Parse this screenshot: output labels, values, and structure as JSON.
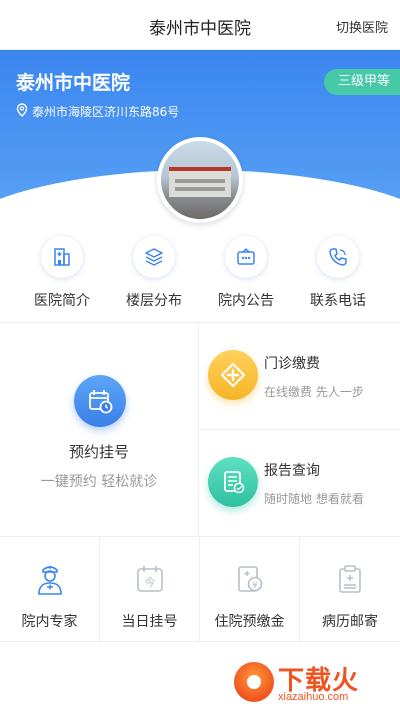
{
  "header": {
    "title": "泰州市中医院",
    "switch_label": "切换医院"
  },
  "hospital": {
    "name": "泰州市中医院",
    "address": "泰州市海陵区济川东路86号",
    "grade": "三级甲等"
  },
  "quick_links": [
    {
      "label": "医院简介",
      "icon": "hospital-building-icon"
    },
    {
      "label": "楼层分布",
      "icon": "layers-icon"
    },
    {
      "label": "院内公告",
      "icon": "notice-board-icon"
    },
    {
      "label": "联系电话",
      "icon": "phone-icon"
    }
  ],
  "features": {
    "appointment": {
      "title": "预约挂号",
      "subtitle": "一键预约 轻松就诊",
      "icon": "calendar-clock-icon"
    },
    "payment": {
      "title": "门诊缴费",
      "subtitle": "在线缴费 先人一步",
      "icon": "plus-diamond-icon"
    },
    "report": {
      "title": "报告查询",
      "subtitle": "随时随地 想看就看",
      "icon": "report-document-icon"
    }
  },
  "bottom_menu": [
    {
      "label": "院内专家",
      "icon": "doctor-icon"
    },
    {
      "label": "当日挂号",
      "icon": "calendar-today-icon"
    },
    {
      "label": "住院预缴金",
      "icon": "deposit-document-icon"
    },
    {
      "label": "病历邮寄",
      "icon": "medical-record-icon"
    }
  ],
  "watermark": {
    "brand": "下载火",
    "url": "xiazaihuo.com"
  },
  "colors": {
    "primary": "#3a86ef",
    "grade_badge": "#45c9a6",
    "payment": "#f6b527",
    "report": "#2fc1a0",
    "watermark": "#f0531e"
  }
}
